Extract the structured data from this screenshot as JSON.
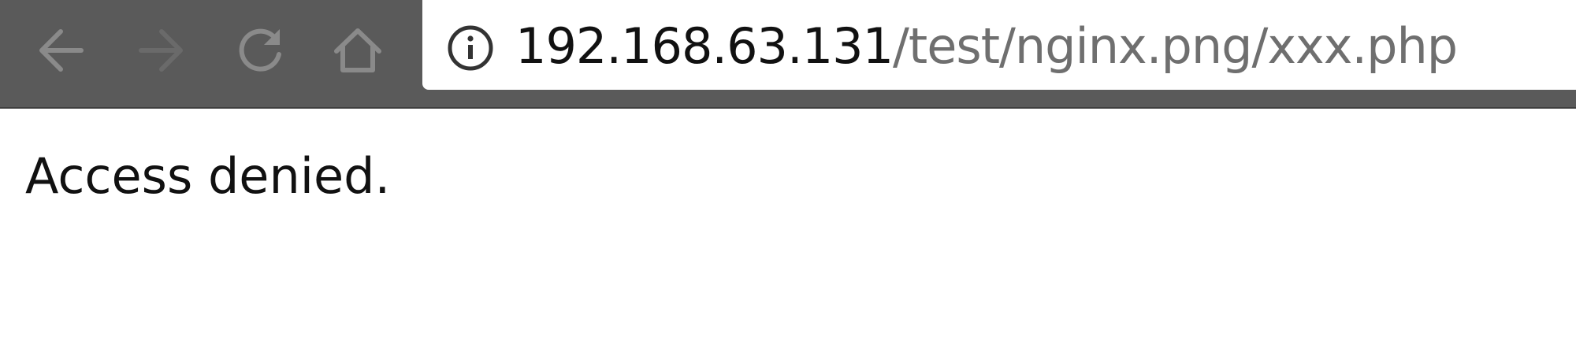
{
  "browser": {
    "toolbar": {
      "back_icon": "back-arrow-icon",
      "forward_icon": "forward-arrow-icon",
      "reload_icon": "reload-icon",
      "home_icon": "home-icon"
    },
    "address_bar": {
      "info_icon": "info-icon",
      "url_host": "192.168.63.131",
      "url_path": "/test/nginx.png/xxx.php"
    },
    "colors": {
      "toolbar_bg": "#5a5a5a",
      "icon_enabled": "#8a8a8a",
      "icon_disabled": "#6a6a6a",
      "url_host": "#111111",
      "url_path": "#6f6f6f"
    }
  },
  "page": {
    "message": "Access denied."
  }
}
